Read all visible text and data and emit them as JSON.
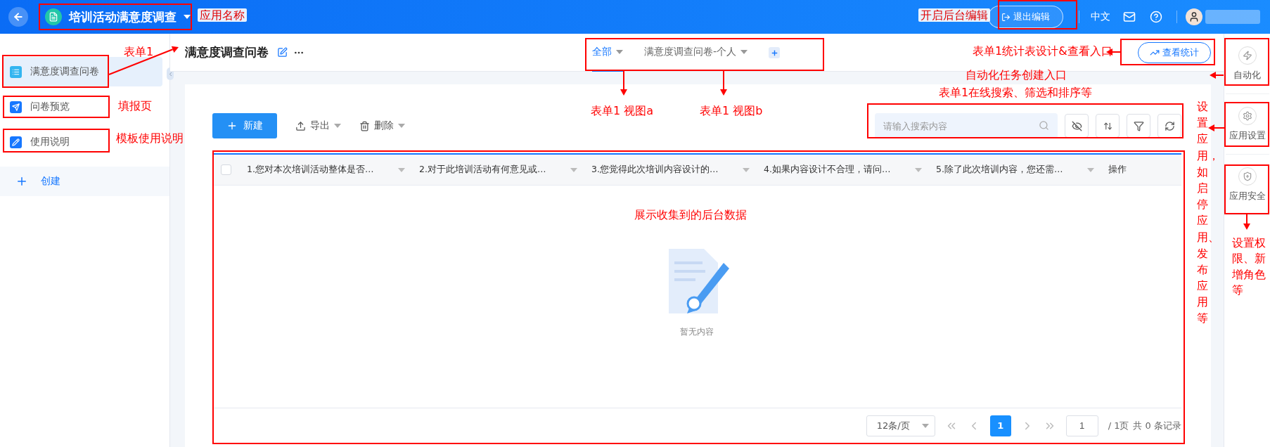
{
  "app_bar": {
    "app_name": "培训活动满意度调查",
    "exit_edit_button": "退出编辑",
    "language": "中文"
  },
  "sidebar": {
    "items": [
      {
        "label": "满意度调查问卷",
        "kind": "form",
        "selected": true
      },
      {
        "label": "问卷预览",
        "kind": "preview",
        "selected": false
      },
      {
        "label": "使用说明",
        "kind": "guide",
        "selected": false
      }
    ],
    "create_button": "创建"
  },
  "page": {
    "title": "满意度调查问卷",
    "views": [
      {
        "label": "全部",
        "selected": true
      },
      {
        "label": "满意度调查问卷-个人",
        "selected": false
      }
    ],
    "stats_button": "查看统计"
  },
  "toolbar": {
    "new_button": "新建",
    "export_button": "导出",
    "delete_button": "删除",
    "search": {
      "placeholder": "请输入搜索内容"
    }
  },
  "table": {
    "select_all": {
      "checked": false
    },
    "columns": [
      {
        "label": "1.您对本次培训活动整体是否…",
        "kind": "question"
      },
      {
        "label": "2.对于此培训活动有何意见或…",
        "kind": "question"
      },
      {
        "label": "3.您觉得此次培训内容设计的…",
        "kind": "question"
      },
      {
        "label": "4.如果内容设计不合理，请问…",
        "kind": "question"
      },
      {
        "label": "5.除了此次培训内容，您还需…",
        "kind": "question"
      },
      {
        "label": "操作",
        "kind": "action"
      }
    ],
    "empty_text": "暂无内容"
  },
  "pagination": {
    "page_size": "12条/页",
    "pages": [
      {
        "label": "1",
        "selected": true
      }
    ],
    "page_input": "1",
    "total_pages": "/ 1页",
    "total_records": "共 0 条记录"
  },
  "right_rail": {
    "items": [
      {
        "label": "自动化",
        "kind": "automation"
      },
      {
        "label": "应用设置",
        "kind": "settings"
      },
      {
        "label": "应用安全",
        "kind": "security"
      }
    ]
  },
  "annotations": [
    {
      "text": "应用名称"
    },
    {
      "text": "开启后台编辑"
    },
    {
      "text": "表单1"
    },
    {
      "text": "表单1统计表设计&查看入口"
    },
    {
      "text": "自动化任务创建入口"
    },
    {
      "text": "填报页"
    },
    {
      "text": "表单1在线搜索、筛选和排序等"
    },
    {
      "text": "表单1 视图a"
    },
    {
      "text": "表单1 视图b"
    },
    {
      "text": "设置应用，如启停应用、发布应用等"
    },
    {
      "text": "模板使用说明"
    },
    {
      "text": "展示收集到的后台数据"
    },
    {
      "text": "设置权限、新增角色等"
    }
  ]
}
